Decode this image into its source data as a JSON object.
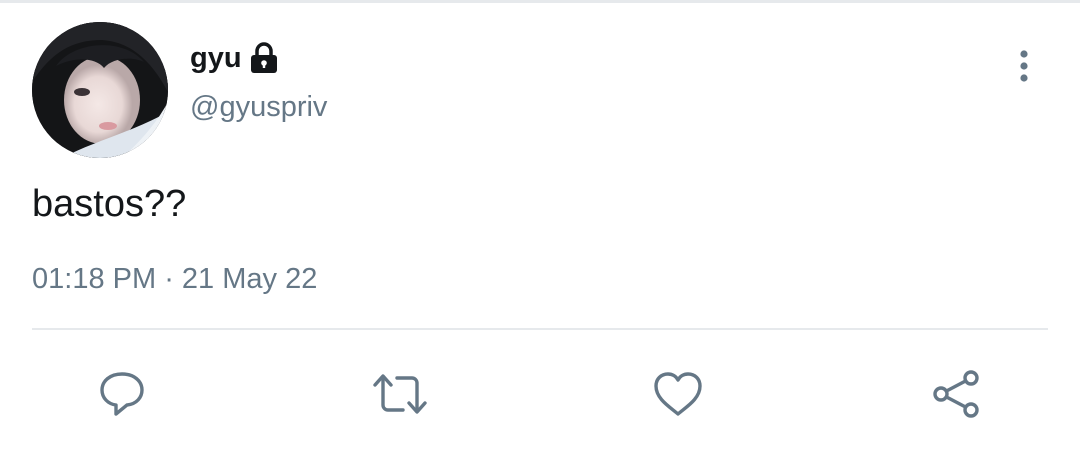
{
  "tweet": {
    "display_name": "gyu",
    "handle": "@gyuspriv",
    "protected_icon": "lock-icon",
    "text": "bastos??",
    "time": "01:18 PM",
    "separator": " · ",
    "date": "21 May 22"
  },
  "actions": {
    "reply_icon": "comment-bubble-icon",
    "retweet_icon": "retweet-icon",
    "like_icon": "heart-icon",
    "share_icon": "share-icon",
    "more_icon": "vertical-dots-icon"
  },
  "colors": {
    "text_primary": "#14171a",
    "text_secondary": "#657786",
    "icon": "#657786",
    "divider": "#e6e9ec"
  }
}
